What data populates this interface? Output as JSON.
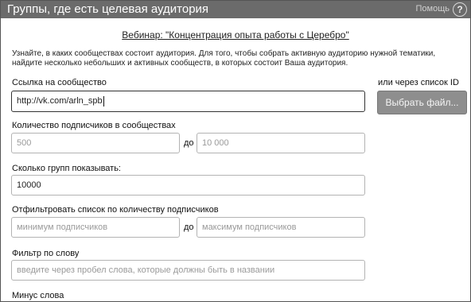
{
  "header": {
    "title": "Группы, где есть целевая аудитория",
    "help_label": "Помощь",
    "help_icon_glyph": "?"
  },
  "webinar_link": "Вебинар: \"Концентрация опыта работы с Церебро\"",
  "description": "Узнайте, в каких сообществах состоит аудитория. Для того, чтобы собрать активную аудиторию нужной тематики, найдите несколько небольших и активных сообществ, в которых состоит Ваша аудитория.",
  "community_link": {
    "label": "Ссылка на сообщество",
    "value": "http://vk.com/arln_spb"
  },
  "id_list": {
    "label": "или через список ID",
    "button_label": "Выбрать файл..."
  },
  "subscribers": {
    "label": "Количество подписчиков в сообществах",
    "from_placeholder": "500",
    "separator": "до",
    "to_placeholder": "10 000"
  },
  "groups_count": {
    "label": "Сколько групп показывать:",
    "value": "10000"
  },
  "filter_subscribers": {
    "label": "Отфильтровать список по количеству подписчиков",
    "min_placeholder": "минимум подписчиков",
    "separator": "до",
    "max_placeholder": "максимум подписчиков"
  },
  "word_filter": {
    "label": "Фильтр по слову",
    "placeholder": "введите через пробел слова, которые должны быть в названии"
  },
  "minus_words": {
    "label": "Минус слова"
  }
}
